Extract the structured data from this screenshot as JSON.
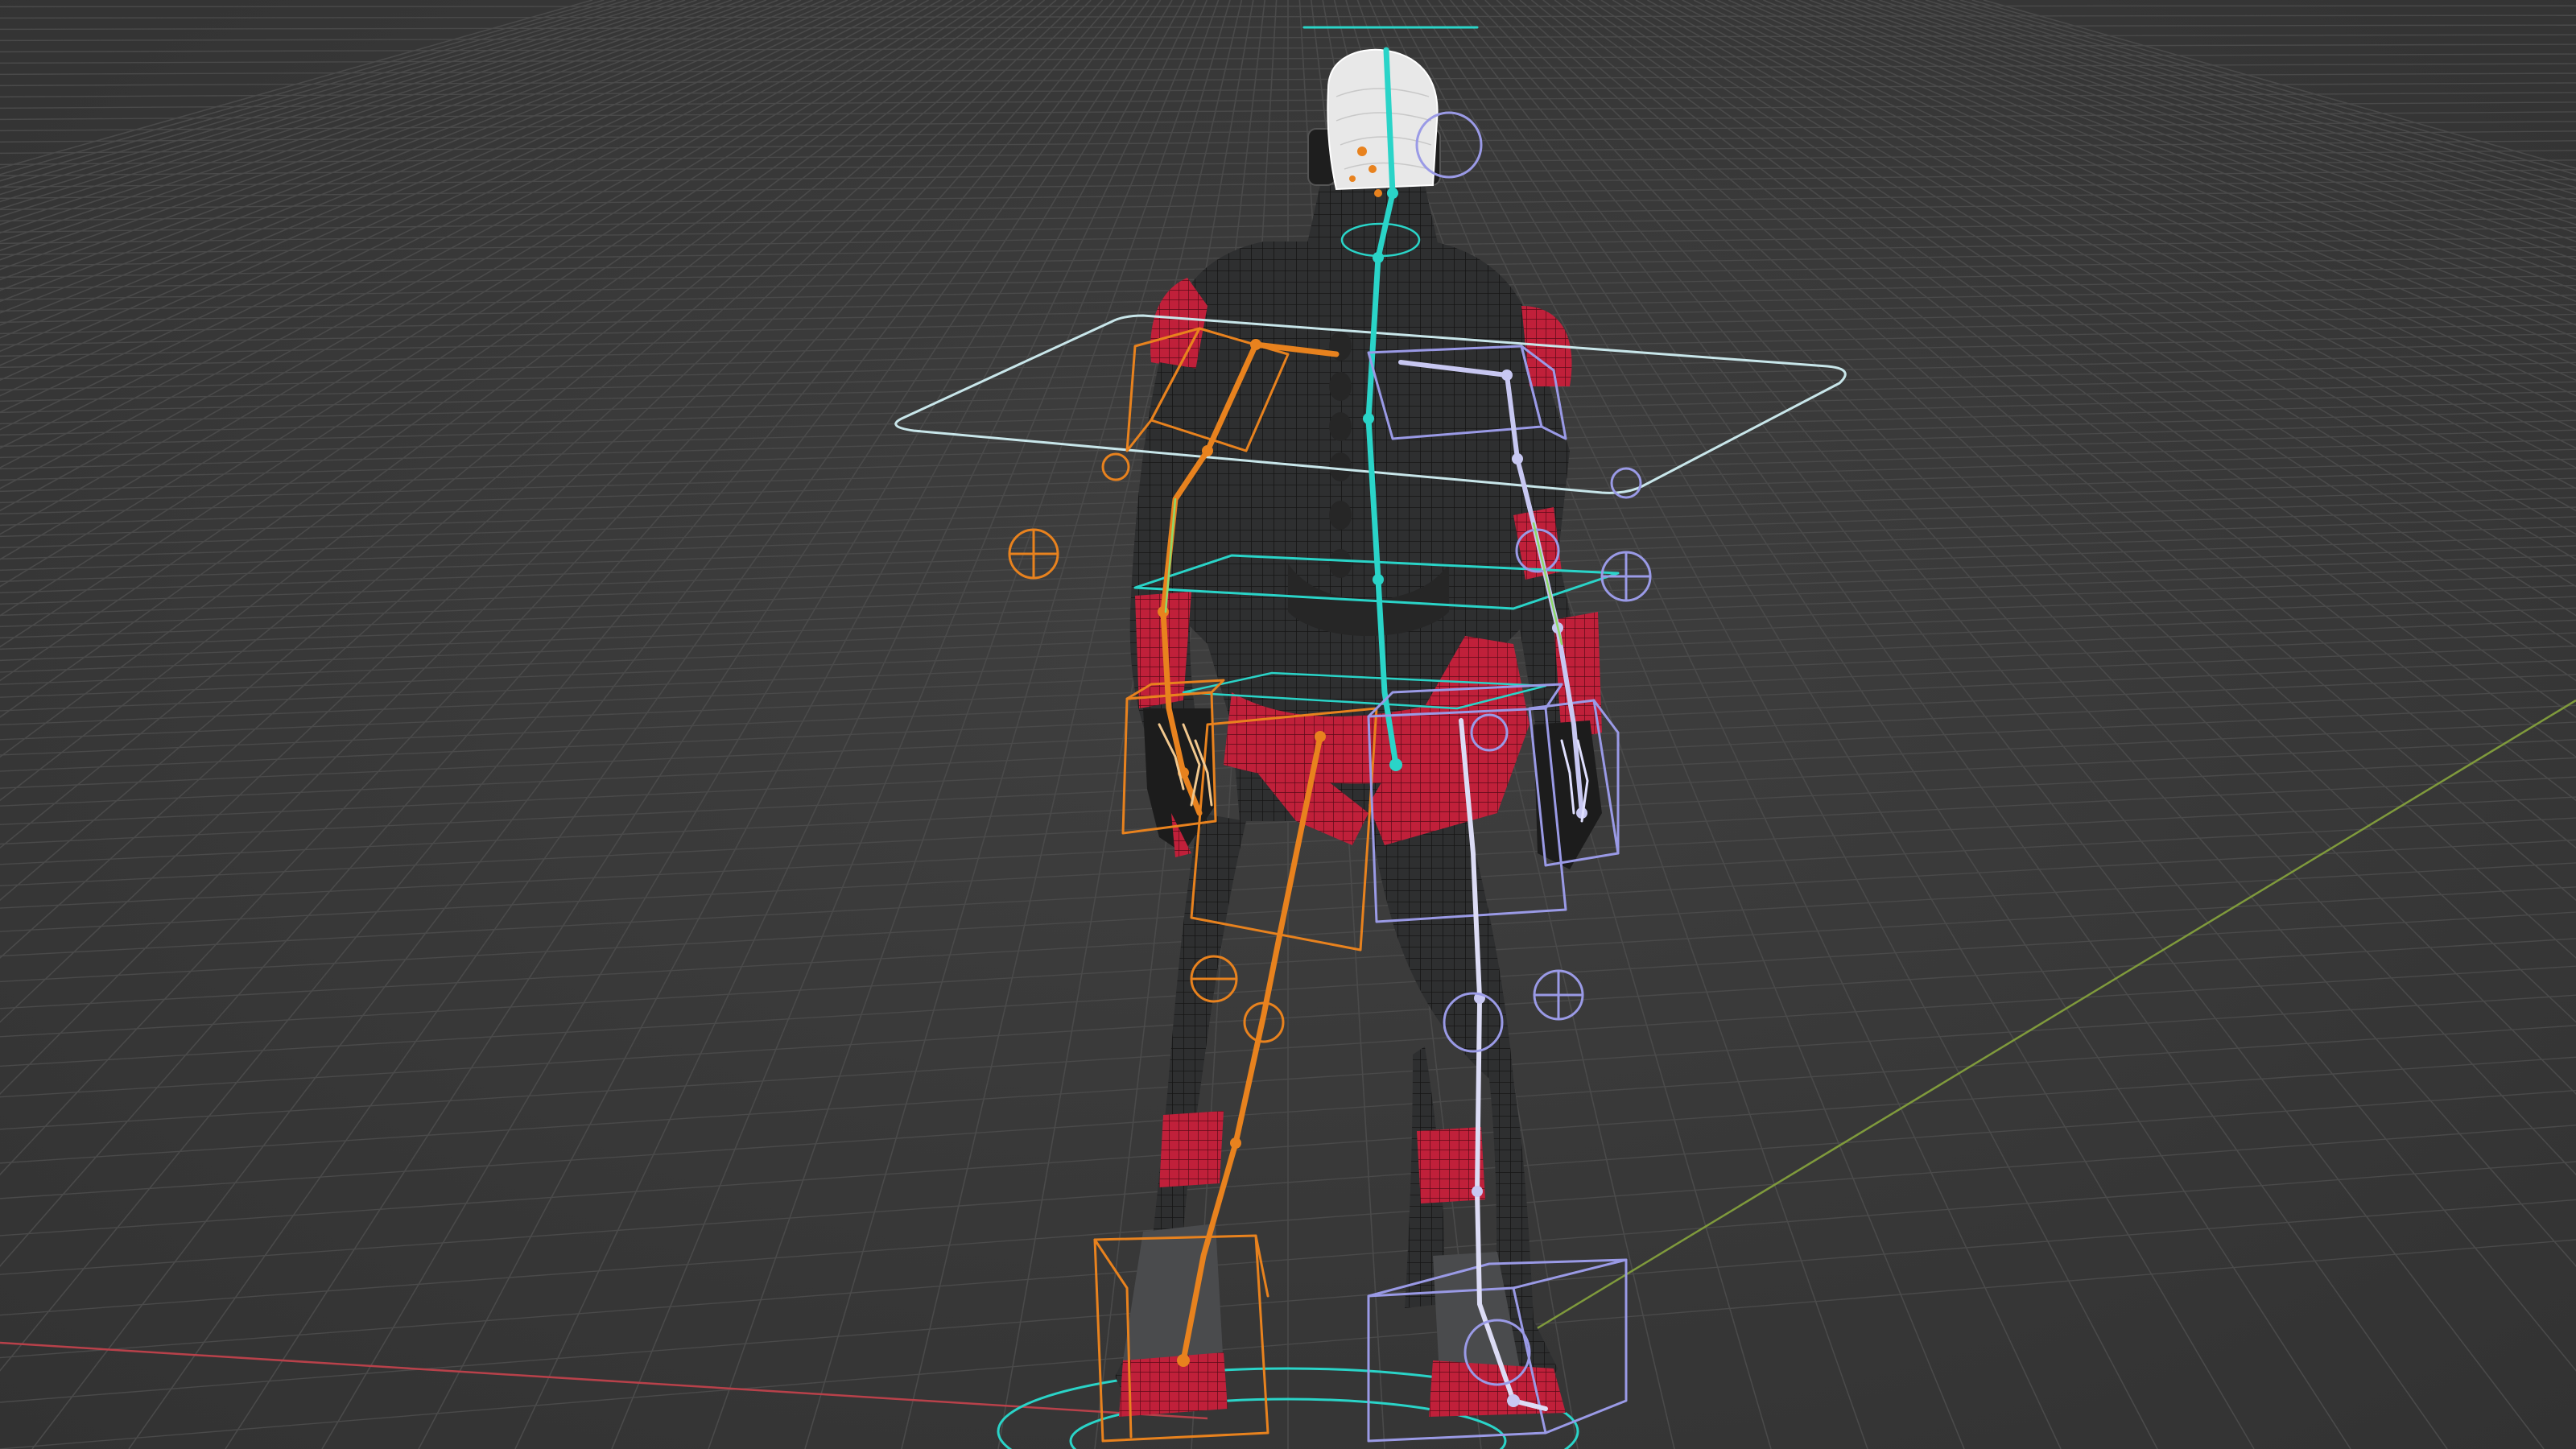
{
  "viewport": {
    "view": "3d-viewport",
    "background_color": "#3a3a3a",
    "grid_color": "#4a4a4a",
    "x_axis_color": "#b8414a",
    "y_axis_color": "#7f9a3c"
  },
  "character": {
    "suit_color": "#2e2f30",
    "armor_color": "#c0203a",
    "wireframe_color": "#141414",
    "hair_color": "#e8e8e8"
  },
  "rig": {
    "spine_color": "#2ad4c8",
    "left_side_color": "#e8821e",
    "right_side_color": "#9a9ae6",
    "control_color": "#c8e6ea",
    "limb_boxes": {
      "left": [
        "upper-arm",
        "hand",
        "thigh",
        "foot"
      ],
      "right": [
        "upper-arm",
        "hand",
        "thigh",
        "foot"
      ]
    },
    "pole_targets": [
      "left-elbow",
      "right-elbow",
      "left-knee",
      "right-knee"
    ]
  }
}
